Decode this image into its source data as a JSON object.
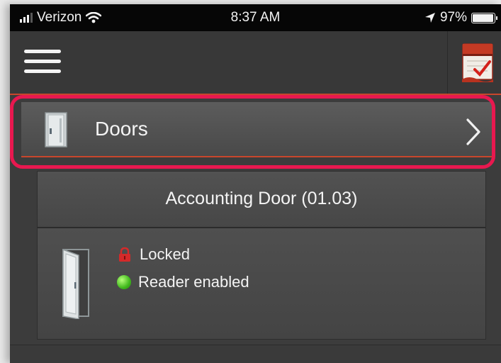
{
  "status_bar": {
    "carrier": "Verizon",
    "time": "8:37 AM",
    "battery": "97%",
    "battery_level": 0.97,
    "icons": [
      "signal-icon",
      "wifi-icon",
      "location-icon",
      "battery-icon"
    ]
  },
  "nav": {
    "menu_icon": "hamburger-menu-icon",
    "app_icon": "calendar-checklist-icon"
  },
  "doors_section": {
    "title": "Doors",
    "icon": "door-icon",
    "chevron": "chevron-right-icon"
  },
  "door": {
    "name": "Accounting Door (01.03)",
    "lock_status": "Locked",
    "reader_status": "Reader enabled"
  },
  "colors": {
    "accent_line": "#c8462c",
    "highlight": "#e8184f",
    "reader_enabled": "#3fb81c",
    "lock_icon": "#d42a2a"
  }
}
